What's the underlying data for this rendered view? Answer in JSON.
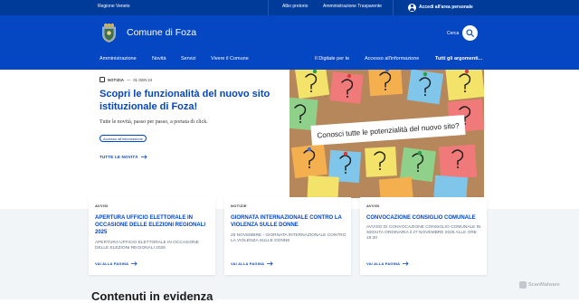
{
  "topbar": {
    "region": "Regione Veneto",
    "links": [
      "Albo pretorio",
      "Amministrazione Trasparente"
    ],
    "access_label": "Accedi all'area personale"
  },
  "header": {
    "site_title": "Comune di Foza",
    "search_label": "Cerca",
    "nav_left": [
      "Amministrazione",
      "Novità",
      "Servizi",
      "Vivere il Comune"
    ],
    "nav_right": [
      "Il Digitale per te",
      "Accesso all'informazione",
      "Tutti gli argomenti..."
    ]
  },
  "hero": {
    "badge": "NOTIZIA",
    "date": "01 GEN 24",
    "title": "Scopri le funzionalità del nuovo sito istituzionale di Foza!",
    "subtitle": "Tutte le novità, passo per passo, a portata di click.",
    "chip": "Accesso all'informazione",
    "all_news": "TUTTE LE NOVITÀ",
    "image_text": "Conosci tutte le potenzialità del nuovo sito?"
  },
  "cards": [
    {
      "category": "AVVISI",
      "title": "APERTURA UFFICIO ELETTORALE IN OCCASIONE DELLE ELEZIONI REGIONALI 2025",
      "description": "APERTURA UFFICIO ELETTORALE IN OCCASIONE DELLE ELEZIONI REGIONALI 2025",
      "more": "VAI ALLA PAGINA"
    },
    {
      "category": "NOTIZIE",
      "title": "GIORNATA INTERNAZIONALE CONTRO LA VIOLENZA SULLE DONNE",
      "description": "25 NOVEMBRE - GIORNATA INTERNAZIONALE CONTRO LA VIOLENZA SULLE DONNE",
      "more": "VAI ALLA PAGINA"
    },
    {
      "category": "AVVISI",
      "title": "CONVOCAZIONE CONSIGLIO COMUNALE",
      "description": "AVVISO DI CONVOCAZIONE CONSIGLIO COMUNALE IN SEDUTA ORDINARIA il 27 NOVEMBRE 2025 ALLE ORE 18:30",
      "more": "VAI ALLA PAGINA"
    }
  ],
  "section_title": "Contenuti in evidenza",
  "watermark": "ScanMalware",
  "colors": {
    "topbar": "#003b9a",
    "header": "#0546c3",
    "accent": "#0546c3",
    "cards_bg": "#f2f5f8"
  }
}
